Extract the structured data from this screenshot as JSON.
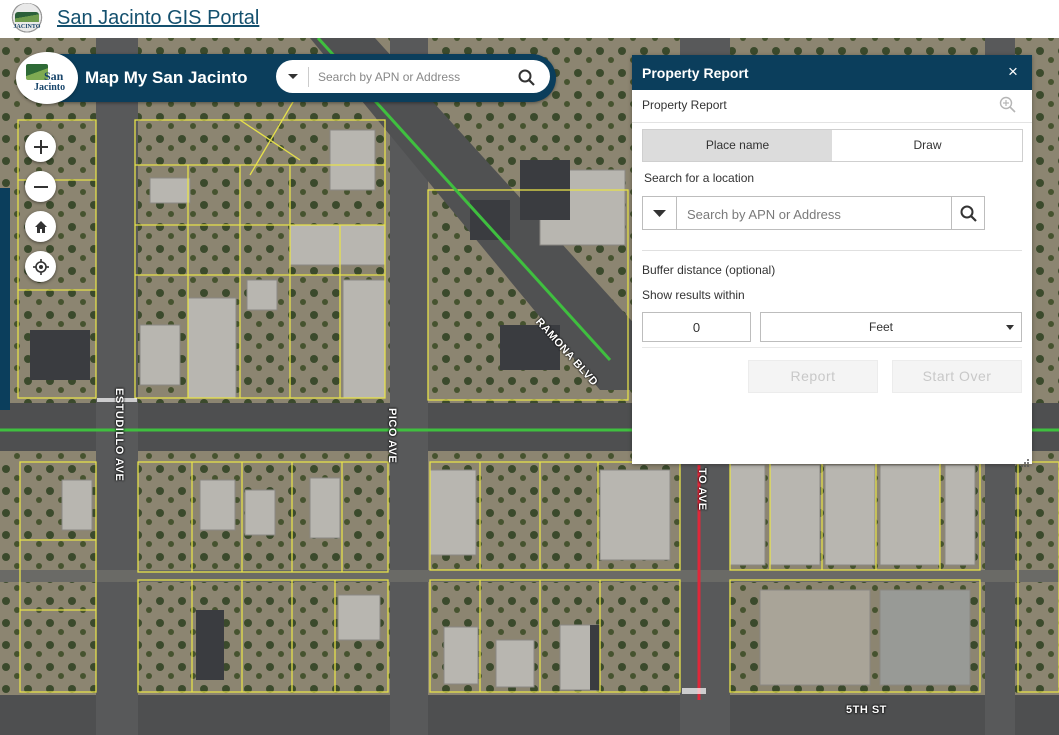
{
  "portal": {
    "title": "San Jacinto GIS Portal",
    "logo_icon": "city-seal-icon",
    "logo_text": "JACINTO"
  },
  "app": {
    "title": "Map My San Jacinto",
    "logo_line1": "San",
    "logo_line2": "Jacinto",
    "search_placeholder": "Search by APN or Address"
  },
  "map": {
    "controls": [
      "zoom-in",
      "zoom-out",
      "home",
      "locate"
    ],
    "road_labels": {
      "ramona": "RAMONA BLVD",
      "pico": "PICO AVE",
      "estudillo": "ESTUDILLO AVE",
      "san_jacinto": "TO AVE",
      "fifth": "5TH ST"
    },
    "colors": {
      "parcel": "#e6e14a",
      "highlight_green": "#3fbf3f",
      "highlight_red": "#e0283a"
    }
  },
  "panel": {
    "title": "Property Report",
    "close_label": "×",
    "subtitle": "Property Report",
    "tabs": [
      {
        "label": "Place name",
        "active": true
      },
      {
        "label": "Draw",
        "active": false
      }
    ],
    "search_label": "Search for a location",
    "search_placeholder": "Search by APN or Address",
    "buffer_label": "Buffer distance (optional)",
    "within_label": "Show results within",
    "buffer_value": "0",
    "unit": "Feet",
    "report_button": "Report",
    "start_over_button": "Start Over"
  },
  "theme": {
    "header_bg": "#0b3e5c"
  }
}
